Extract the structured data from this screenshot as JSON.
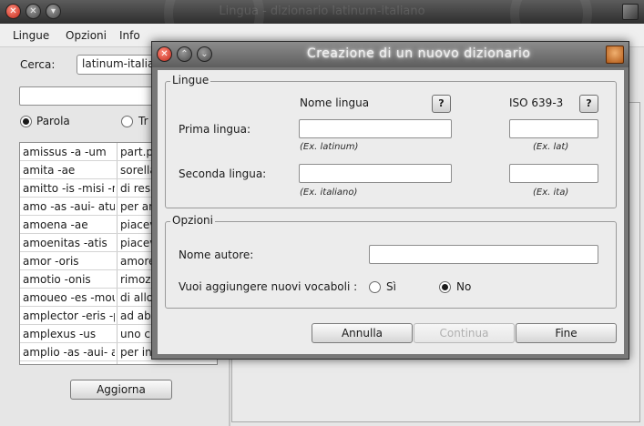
{
  "main_window": {
    "title": "Lingua - dizionario latinum-italiano",
    "menu": [
      "Lingue",
      "Opzioni",
      "Info"
    ],
    "search_label": "Cerca:",
    "dictionary_selected": "latinum-italiano",
    "search_value": "",
    "mode_options": [
      {
        "label": "Parola",
        "selected": true
      },
      {
        "label": "Tr",
        "selected": false
      }
    ],
    "word_rows": [
      {
        "word": "amissus -a -um",
        "translation": "part.p"
      },
      {
        "word": "amita -ae",
        "translation": "sorella"
      },
      {
        "word": "amitto -is -misi -n",
        "translation": "di res"
      },
      {
        "word": "amo -as -aui- atu",
        "translation": "per am"
      },
      {
        "word": "amoena -ae",
        "translation": "piacev"
      },
      {
        "word": "amoenitas -atis",
        "translation": "piacev"
      },
      {
        "word": "amor -oris",
        "translation": "amore"
      },
      {
        "word": "amotio -onis",
        "translation": "rimozi"
      },
      {
        "word": "amoueo -es -mou",
        "translation": "di allo"
      },
      {
        "word": "amplector -eris -p",
        "translation": "ad abb"
      },
      {
        "word": "amplexus -us",
        "translation": "uno ci"
      },
      {
        "word": "amplio -as -aui- a",
        "translation": "per in"
      }
    ],
    "refresh_button": "Aggiorna"
  },
  "dialog": {
    "title": "Creazione di un nuovo dizionario",
    "languages_group": {
      "title": "Lingue",
      "name_header": "Nome lingua",
      "iso_header": "ISO 639-3",
      "help_label": "?",
      "first_label": "Prima lingua:",
      "first_name_value": "",
      "first_iso_value": "",
      "first_name_hint": "(Ex. latinum)",
      "first_iso_hint": "(Ex. lat)",
      "second_label": "Seconda lingua:",
      "second_name_value": "",
      "second_iso_value": "",
      "second_name_hint": "(Ex. italiano)",
      "second_iso_hint": "(Ex. ita)"
    },
    "options_group": {
      "title": "Opzioni",
      "author_label": "Nome autore:",
      "author_value": "",
      "add_words_label": "Vuoi aggiungere nuovi vocaboli :",
      "yes_label": "Sì",
      "no_label": "No",
      "selected": "No"
    },
    "buttons": {
      "cancel": "Annulla",
      "continue": "Continua",
      "finish": "Fine"
    }
  }
}
